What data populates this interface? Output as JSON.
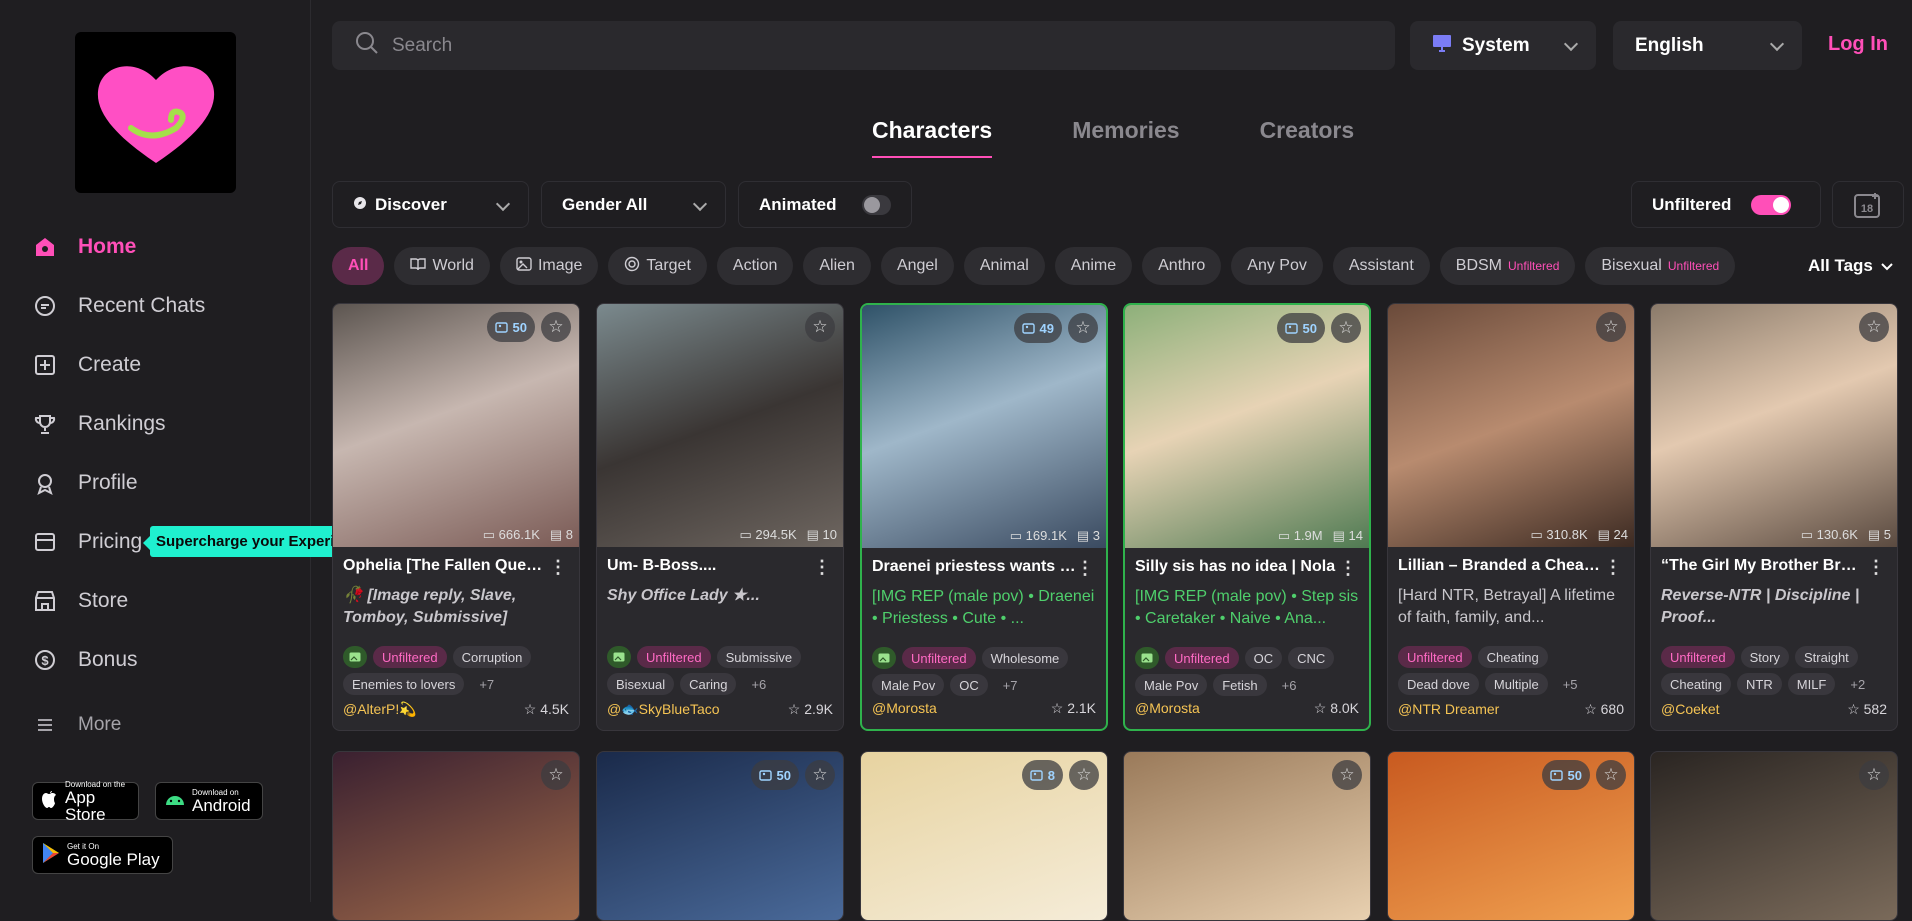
{
  "sidebar": {
    "nav": [
      {
        "label": "Home",
        "icon": "home-icon"
      },
      {
        "label": "Recent Chats",
        "icon": "chat-icon"
      },
      {
        "label": "Create",
        "icon": "plus-square-icon"
      },
      {
        "label": "Rankings",
        "icon": "trophy-icon"
      },
      {
        "label": "Profile",
        "icon": "profile-icon"
      },
      {
        "label": "Pricing",
        "icon": "card-icon"
      },
      {
        "label": "Store",
        "icon": "store-icon"
      },
      {
        "label": "Bonus",
        "icon": "dollar-circle-icon"
      },
      {
        "label": "More",
        "icon": "menu-icon"
      }
    ],
    "tooltip": "Supercharge your Experience",
    "badges": {
      "appstore_small": "Download on the",
      "appstore_big": "App Store",
      "android_small": "Download on",
      "android_big": "Android",
      "gplay_small": "Get it On",
      "gplay_big": "Google Play"
    }
  },
  "header": {
    "search_placeholder": "Search",
    "theme": "System",
    "language": "English",
    "login": "Log In"
  },
  "tabs": [
    "Characters",
    "Memories",
    "Creators"
  ],
  "filters": {
    "discover": "Discover",
    "gender": "Gender All",
    "animated": "Animated",
    "unfiltered": "Unfiltered"
  },
  "chips": [
    {
      "label": "All"
    },
    {
      "label": "World"
    },
    {
      "label": "Image"
    },
    {
      "label": "Target"
    },
    {
      "label": "Action"
    },
    {
      "label": "Alien"
    },
    {
      "label": "Angel"
    },
    {
      "label": "Animal"
    },
    {
      "label": "Anime"
    },
    {
      "label": "Anthro"
    },
    {
      "label": "Any Pov"
    },
    {
      "label": "Assistant"
    },
    {
      "label": "BDSM",
      "badge": "Unfiltered"
    },
    {
      "label": "Bisexual",
      "badge": "Unfiltered"
    }
  ],
  "all_tags": "All Tags",
  "cards": [
    {
      "title": "Ophelia [The Fallen Queen]",
      "desc": "🥀 [Image reply, Slave, Tomboy, Submissive]",
      "chats": "666.1K",
      "memories": "8",
      "img_count": "50",
      "tags": [
        "Unfiltered",
        "Corruption",
        "Enemies to lovers",
        "+7"
      ],
      "creator": "@AlterP!💫",
      "likes": "4.5K"
    },
    {
      "title": "Um- B-Boss....",
      "desc": "Shy Office Lady\n★...",
      "chats": "294.5K",
      "memories": "10",
      "img_count": "",
      "tags": [
        "Unfiltered",
        "Submissive",
        "Bisexual",
        "Caring",
        "+6"
      ],
      "creator": "@🐟SkyBlueTaco",
      "likes": "2.9K"
    },
    {
      "title": "Draenei priestess wants you",
      "desc": "[IMG REP (male pov) • Draenei • Priestess • Cute • ...",
      "chats": "169.1K",
      "memories": "3",
      "img_count": "49",
      "tags": [
        "Unfiltered",
        "Wholesome",
        "Male Pov",
        "OC",
        "+7"
      ],
      "creator": "@Morosta",
      "likes": "2.1K"
    },
    {
      "title": "Silly sis has no idea | Nola",
      "desc": "[IMG REP (male pov) • Step sis • Caretaker • Naive • Ana...",
      "chats": "1.9M",
      "memories": "14",
      "img_count": "50",
      "tags": [
        "Unfiltered",
        "OC",
        "CNC",
        "Male Pov",
        "Fetish",
        "+6"
      ],
      "creator": "@Morosta",
      "likes": "8.0K"
    },
    {
      "title": "Lillian – Branded a Cheater",
      "desc": "[Hard NTR, Betrayal] A lifetime of faith, family, and...",
      "chats": "310.8K",
      "memories": "24",
      "img_count": "",
      "tags": [
        "Unfiltered",
        "Cheating",
        "Dead dove",
        "Multiple",
        "+5"
      ],
      "creator": "@NTR Dreamer",
      "likes": "680"
    },
    {
      "title": "“The Girl My Brother Brought Home”",
      "desc": "Reverse-NTR | Discipline | Proof...",
      "chats": "130.6K",
      "memories": "5",
      "img_count": "",
      "tags": [
        "Unfiltered",
        "Story",
        "Straight",
        "Cheating",
        "NTR",
        "MILF",
        "+2"
      ],
      "creator": "@Coeket",
      "likes": "582"
    }
  ],
  "row2_counts": [
    "",
    "50",
    "8",
    "",
    "50",
    ""
  ],
  "colors": {
    "accent": "#ff4fb8",
    "teal": "#1ff0cf",
    "bg": "#1f1e21"
  }
}
